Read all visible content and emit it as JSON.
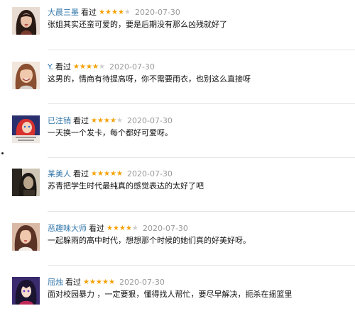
{
  "comments": [
    {
      "username": "大晨三墨",
      "status": "看过",
      "rating": 4,
      "date": "2020-07-30",
      "text": "张姐其实还蛮可爱的，要是后期没有那么凶残就好了",
      "avatar_icon": "avatar-woman-dark-hair",
      "avatar_color": "#6b4a3a"
    },
    {
      "username": "Y.",
      "status": "看过",
      "rating": 4,
      "date": "2020-07-30",
      "text": "这男的，情商有待提高呀，你不需要雨衣，也别这么直接呀",
      "avatar_icon": "avatar-woman-smiling",
      "avatar_color": "#c98f6e"
    },
    {
      "username": "已注销",
      "status": "看过",
      "rating": 4,
      "date": "2020-07-30",
      "text": "一天换一个发卡，每个都好可爱呀。",
      "avatar_icon": "avatar-cartoon-mermaid",
      "avatar_color": "#2a2f6e"
    },
    {
      "username": "某美人",
      "status": "看过",
      "rating": 5,
      "date": "2020-07-30",
      "text": "苏青把学生时代最纯真的感觉表达的太好了吧",
      "avatar_icon": "avatar-sepia-portrait",
      "avatar_color": "#4a4035"
    },
    {
      "username": "恶趣味大师",
      "status": "看过",
      "rating": 4,
      "date": "2020-07-30",
      "text": "一起躲雨的高中时代，想想那个时候的她们真的好美好呀。",
      "avatar_icon": "avatar-woman-portrait",
      "avatar_color": "#b07a66"
    },
    {
      "username": "屈烛",
      "status": "看过",
      "rating": 5,
      "date": "2020-07-30",
      "text": "面对校园暴力 ，一定要狠，懂得找人帮忙，要尽早解决，扼杀在摇篮里",
      "avatar_icon": "avatar-anime-girl",
      "avatar_color": "#3a2a6e"
    }
  ],
  "star_colors": {
    "on": "#f4a000",
    "off": "#cfcfcf"
  },
  "username_color": "#3377aa"
}
